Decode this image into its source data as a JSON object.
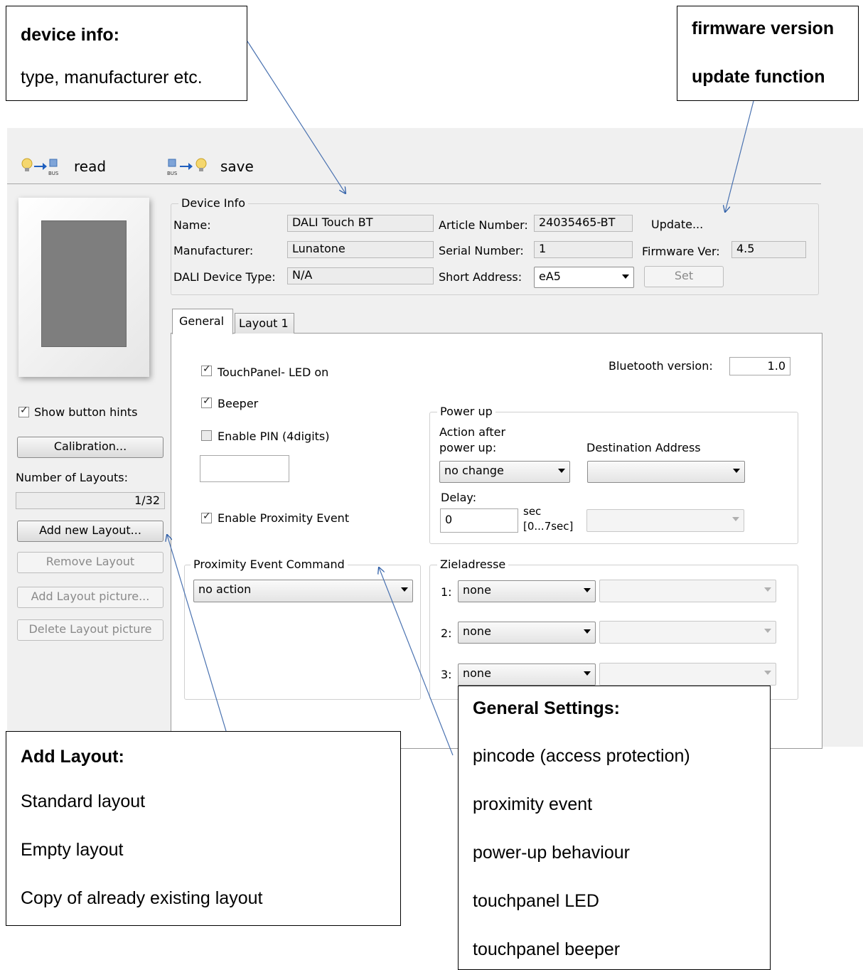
{
  "callouts": {
    "device_info": {
      "title": "device info:",
      "lines": [
        "type, manufacturer etc."
      ]
    },
    "firmware": {
      "title": "firmware version",
      "title2": "update function"
    },
    "add_layout": {
      "title": "Add Layout:",
      "lines": [
        "Standard layout",
        "Empty layout",
        "Copy of already existing layout"
      ]
    },
    "general_settings": {
      "title": "General Settings:",
      "lines": [
        "pincode (access protection)",
        "proximity event",
        "power-up behaviour",
        "touchpanel LED",
        "touchpanel  beeper"
      ]
    }
  },
  "toolbar": {
    "read_label": "read",
    "save_label": "save"
  },
  "device_info": {
    "group_title": "Device Info",
    "name_label": "Name:",
    "name_value": "DALI Touch BT",
    "manufacturer_label": "Manufacturer:",
    "manufacturer_value": "Lunatone",
    "device_type_label": "DALI Device Type:",
    "device_type_value": "N/A",
    "article_label": "Article Number:",
    "article_value": "24035465-BT",
    "serial_label": "Serial Number:",
    "serial_value": "1",
    "short_address_label": "Short Address:",
    "short_address_value": "eA5",
    "update_label": "Update...",
    "firmware_label": "Firmware Ver:",
    "firmware_value": "4.5",
    "set_label": "Set"
  },
  "sidebar": {
    "show_hints_label": "Show button hints",
    "calibration_label": "Calibration...",
    "layouts_label": "Number of Layouts:",
    "layouts_value": "1/32",
    "add_layout_label": "Add new Layout...",
    "remove_layout_label": "Remove  Layout",
    "add_picture_label": "Add Layout picture...",
    "delete_picture_label": "Delete Layout picture"
  },
  "tabs": {
    "general": "General",
    "layout1": "Layout 1"
  },
  "general": {
    "led_label": "TouchPanel- LED on",
    "beeper_label": "Beeper",
    "pin_label": "Enable PIN (4digits)",
    "proximity_label": "Enable Proximity Event",
    "bluetooth_label": "Bluetooth version:",
    "bluetooth_value": "1.0",
    "powerup": {
      "group_title": "Power up",
      "action_label_1": "Action after",
      "action_label_2": "power up:",
      "dest_label": "Destination Address",
      "action_value": "no change",
      "delay_label": "Delay:",
      "delay_value": "0",
      "sec_label_1": "sec",
      "sec_label_2": "[0...7sec]"
    },
    "proximity_cmd": {
      "group_title": "Proximity Event Command",
      "value": "no action"
    },
    "zieladresse": {
      "group_title": "Zieladresse",
      "rows": [
        {
          "label": "1:",
          "value": "none"
        },
        {
          "label": "2:",
          "value": "none"
        },
        {
          "label": "3:",
          "value": "none"
        }
      ]
    }
  }
}
